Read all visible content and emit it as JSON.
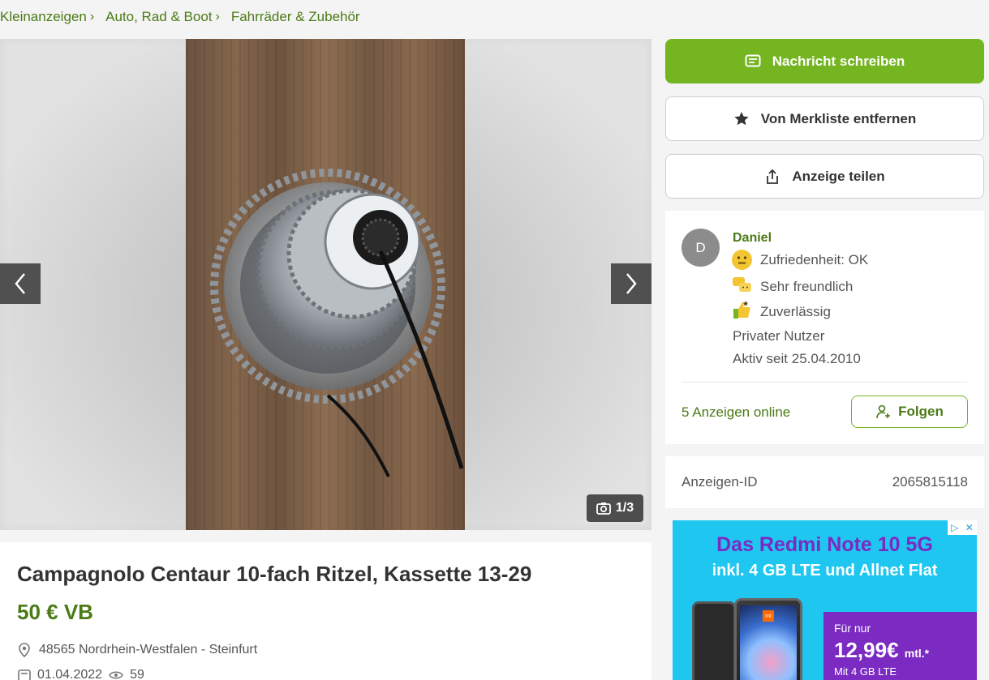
{
  "breadcrumb": [
    {
      "label": "Kleinanzeigen"
    },
    {
      "label": "Auto, Rad & Boot"
    },
    {
      "label": "Fahrräder & Zubehör"
    }
  ],
  "gallery": {
    "counter": "1/3",
    "icons": {
      "prev": "chevron-left-icon",
      "next": "chevron-right-icon",
      "camera": "camera-icon"
    }
  },
  "listing": {
    "title": "Campagnolo Centaur 10-fach Ritzel, Kassette 13-29",
    "price": "50 € VB",
    "location": "48565 Nordrhein-Westfalen - Steinfurt",
    "date": "01.04.2022",
    "views": "59"
  },
  "actions": {
    "message_label": "Nachricht schreiben",
    "watchlist_label": "Von Merkliste entfernen",
    "share_label": "Anzeige teilen"
  },
  "seller": {
    "avatar_initial": "D",
    "name": "Daniel",
    "badges": [
      {
        "label": "Zufriedenheit: OK",
        "icon": "neutral-face-icon"
      },
      {
        "label": "Sehr freundlich",
        "icon": "chat-bubbles-icon"
      },
      {
        "label": "Zuverlässig",
        "icon": "thumbs-up-icon"
      }
    ],
    "type": "Privater Nutzer",
    "active_since": "Aktiv seit 25.04.2010",
    "ads_online": "5 Anzeigen online",
    "follow_label": "Folgen"
  },
  "ad_id": {
    "label": "Anzeigen-ID",
    "value": "2065815118"
  },
  "ad_banner": {
    "headline": "Das Redmi Note 10 5G",
    "subline": "inkl. 4 GB LTE und Allnet Flat",
    "offer_prefix": "Für nur",
    "offer_price": "12,99€",
    "offer_unit": "mtl.*",
    "offer_detail": "Mit 4 GB LTE",
    "phone_brand": "mi"
  },
  "colors": {
    "accent": "#74b521",
    "link": "#4b7a16",
    "ad_bg": "#1ec6f0",
    "ad_purple": "#7b2ac2"
  }
}
